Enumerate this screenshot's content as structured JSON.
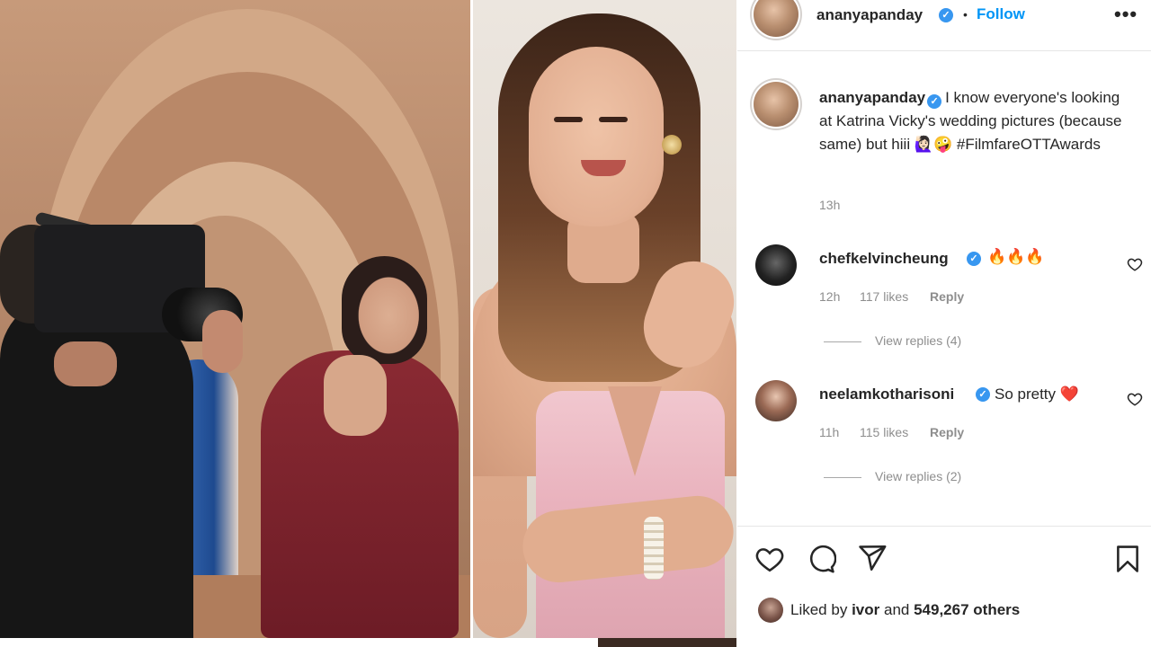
{
  "post": {
    "username": "ananyapanday",
    "follow_label": "Follow",
    "dot": "•",
    "more": "•••",
    "caption_username": "ananyapanday",
    "caption_text": "I know everyone's looking at Katrina Vicky's wedding pictures (because same) but hiii 🙋🏻‍♀️🤪 #FilmfareOTTAwards",
    "caption_time": "13h"
  },
  "comments": [
    {
      "username": "chefkelvincheung",
      "verified": true,
      "text": "🔥🔥🔥",
      "time": "12h",
      "likes": "117 likes",
      "reply_label": "Reply",
      "view_replies": "View replies (4)"
    },
    {
      "username": "neelamkotharisoni",
      "verified": true,
      "text": "So pretty ❤️",
      "time": "11h",
      "likes": "115 likes",
      "reply_label": "Reply",
      "view_replies": "View replies (2)"
    }
  ],
  "footer": {
    "liked_by_prefix": "Liked by",
    "liked_by_user": "ivor",
    "liked_by_and": "and",
    "liked_by_others": "549,267 others"
  },
  "icons": {
    "verified": "verified-badge-icon",
    "like": "heart-icon",
    "comment": "comment-icon",
    "share": "paper-plane-icon",
    "save": "bookmark-icon",
    "more": "more-options-icon"
  },
  "colors": {
    "link_blue": "#0095f6",
    "verified_blue": "#3897f0",
    "text": "#262626",
    "muted": "#8e8e8e"
  }
}
